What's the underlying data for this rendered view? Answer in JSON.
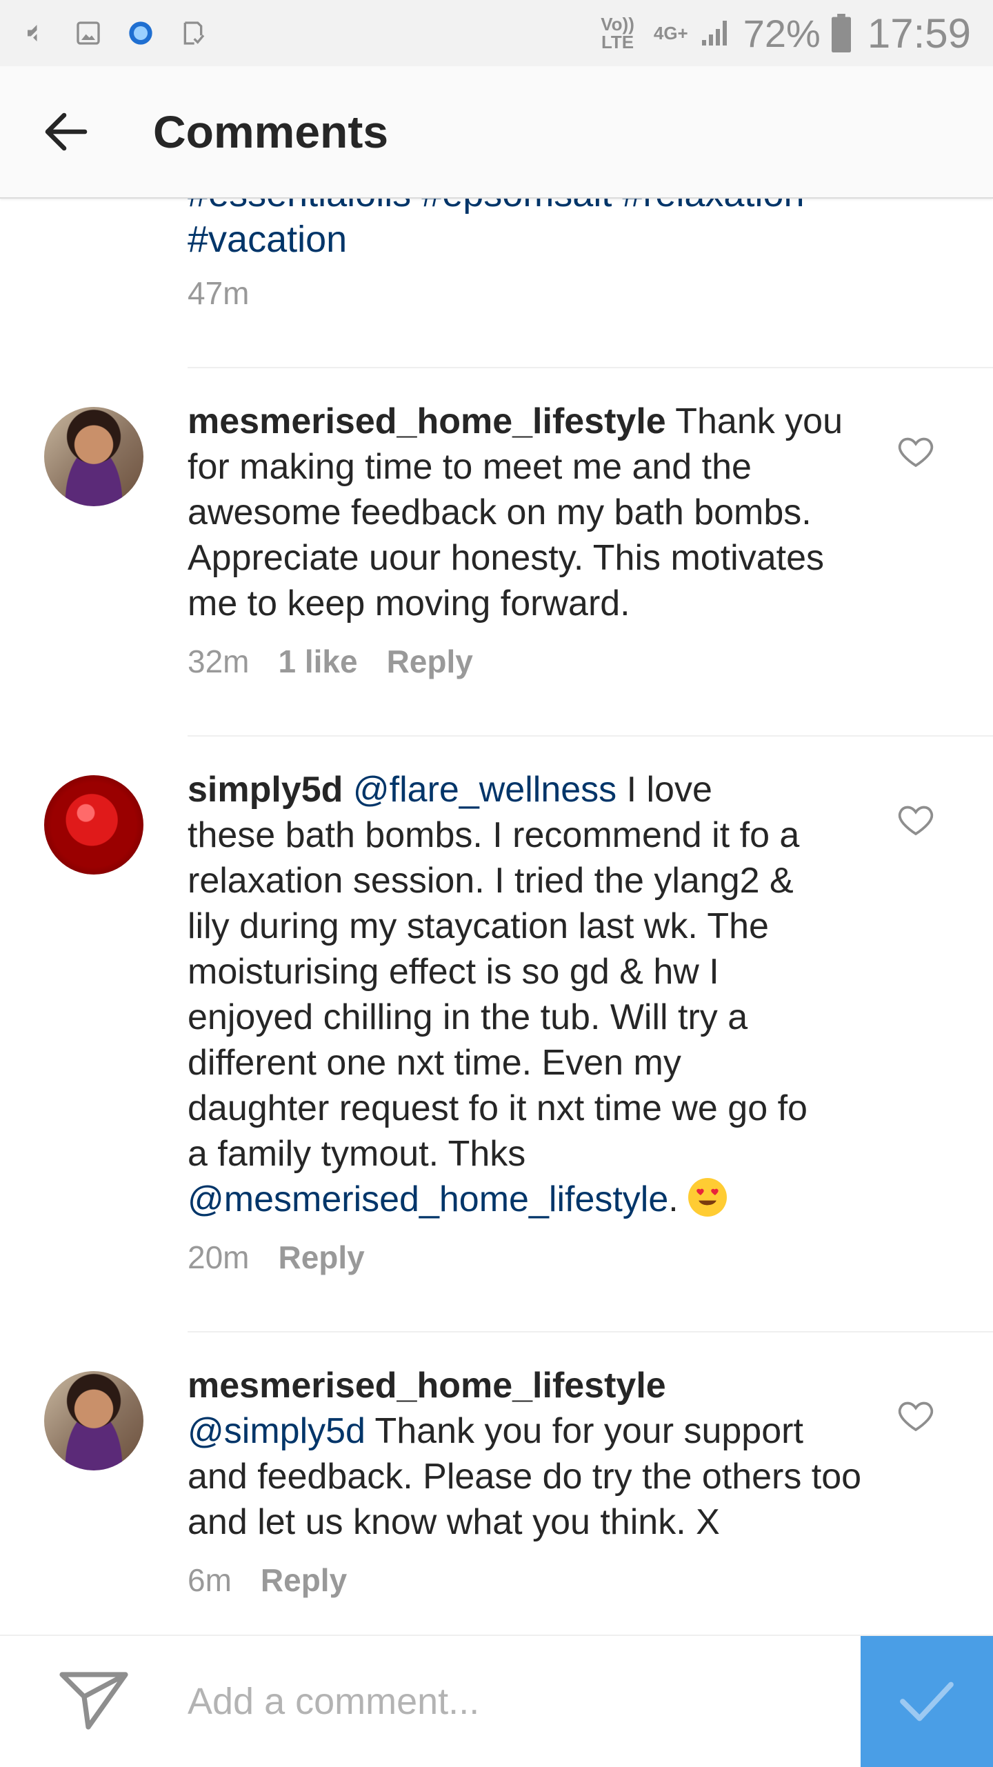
{
  "status_bar": {
    "network_label_top": "Vo))",
    "network_label_bottom": "LTE",
    "data_type": "4G+",
    "battery_percent": "72%",
    "time": "17:59",
    "icons": [
      "mute-icon",
      "gallery-icon",
      "app-circle-icon",
      "check-note-icon",
      "signal-icon",
      "battery-icon"
    ]
  },
  "header": {
    "title": "Comments",
    "back_icon": "arrow-left-icon"
  },
  "caption_tail": {
    "hashtags_line1": "#essentialoils #epsomsalt #relaxation",
    "hashtags_line2": "#vacation",
    "time": "47m"
  },
  "comments": [
    {
      "username": "mesmerised_home_lifestyle",
      "text": " Thank you for making time to meet me and the awesome feedback on my bath bombs.  Appreciate uour honesty.  This motivates me to keep moving forward.",
      "time": "32m",
      "likes": "1 like",
      "reply_label": "Reply"
    },
    {
      "username": "simply5d",
      "mention1": "@flare_wellness",
      "text": " I love these bath bombs. I recommend it fo a relaxation session. I tried the ylang2 & lily during my staycation last wk. The moisturising effect is so gd & hw I enjoyed chilling in the tub. Will try a different one nxt time. Even my daughter request fo it nxt time we go fo a family tymout. Thks ",
      "mention2": "@mesmerised_home_lifestyle",
      "text_end": ". ",
      "time": "20m",
      "reply_label": "Reply"
    },
    {
      "username": "mesmerised_home_lifestyle",
      "mention1": "@simply5d",
      "text": " Thank you for your support and feedback.  Please do try the others too and let us know what you think. X",
      "time": "6m",
      "reply_label": "Reply"
    }
  ],
  "comment_bar": {
    "placeholder": "Add a comment...",
    "send_icon": "paper-plane-icon",
    "post_icon": "checkmark-icon"
  },
  "colors": {
    "mention": "#003569",
    "meta": "#999999",
    "post_button": "#4a9ee6"
  }
}
